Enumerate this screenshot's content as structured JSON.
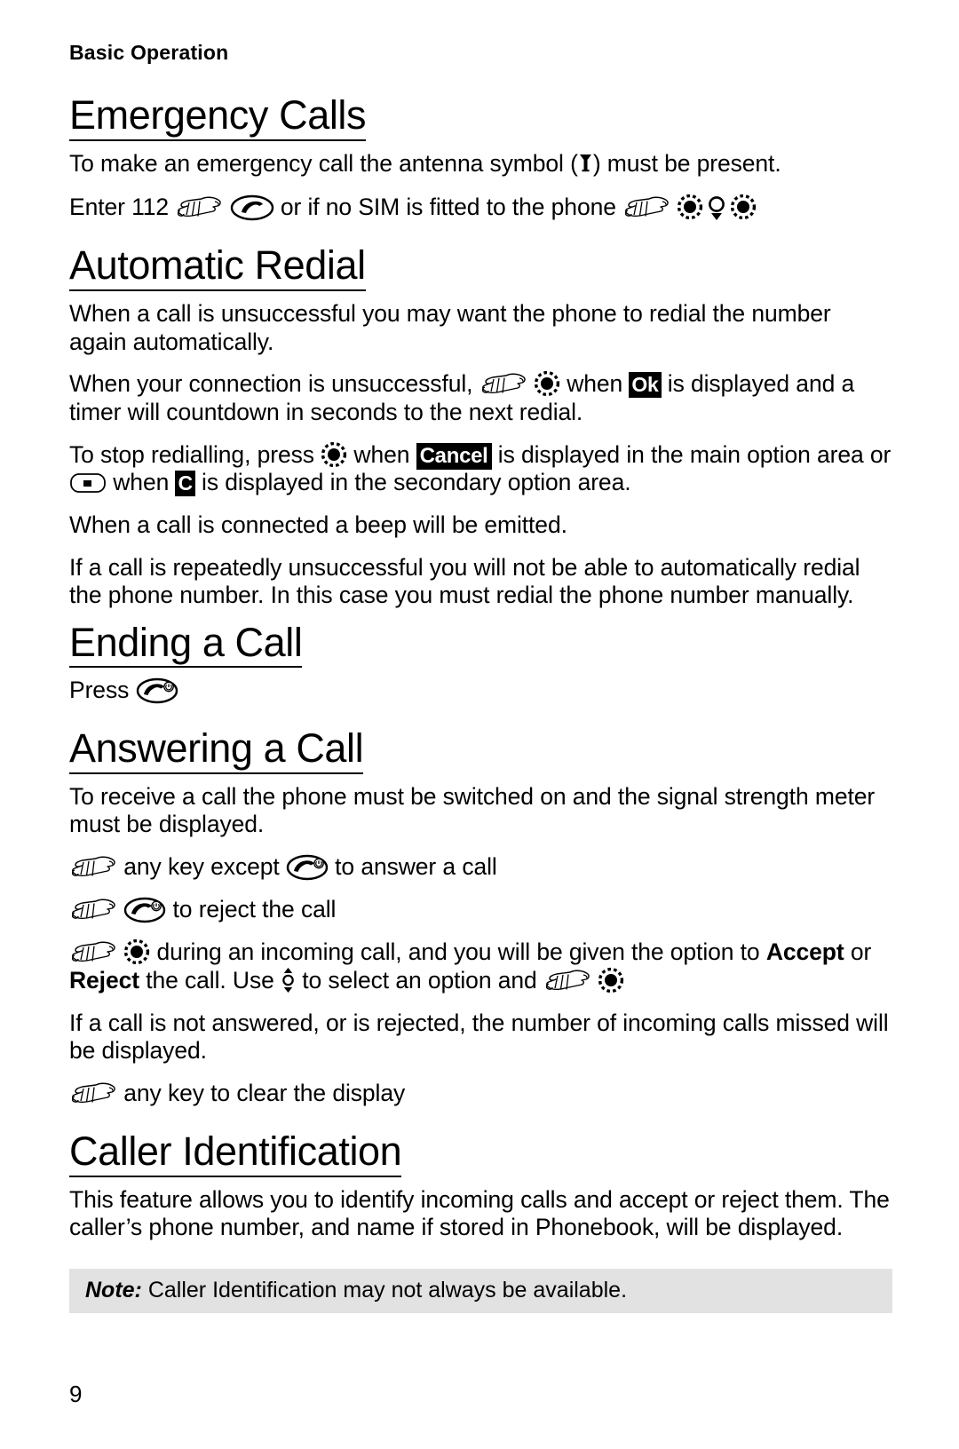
{
  "page": {
    "running_head": "Basic Operation",
    "folio": "9",
    "background": "#ffffff",
    "text_color": "#000000",
    "note_background": "#e2e2e2"
  },
  "sections": [
    {
      "id": "emergency-calls",
      "heading": "Emergency Calls",
      "paragraphs": [
        {
          "id": "emergency-antenna",
          "parts": [
            {
              "type": "text",
              "value": "To make an emergency call the antenna symbol ("
            },
            {
              "type": "icon",
              "icon": "antenna-icon"
            },
            {
              "type": "text",
              "value": ") must be present."
            }
          ]
        },
        {
          "id": "emergency-enter-112",
          "parts": [
            {
              "type": "text",
              "value": "Enter 112 "
            },
            {
              "type": "icon",
              "icon": "press-hand-icon"
            },
            {
              "type": "text",
              "value": " "
            },
            {
              "type": "icon",
              "icon": "send-key-icon"
            },
            {
              "type": "text",
              "value": " or if no SIM is fitted to the phone "
            },
            {
              "type": "icon",
              "icon": "press-hand-icon"
            },
            {
              "type": "text",
              "value": " "
            },
            {
              "type": "icon",
              "icon": "select-key-icon"
            },
            {
              "type": "icon",
              "icon": "navigation-key-icon"
            },
            {
              "type": "icon",
              "icon": "select-key-icon"
            }
          ]
        }
      ]
    },
    {
      "id": "automatic-redial",
      "heading": "Automatic Redial",
      "paragraphs": [
        {
          "id": "redial-intro",
          "parts": [
            {
              "type": "text",
              "value": "When a call is unsuccessful you may want the phone to redial the number again automatically."
            }
          ]
        },
        {
          "id": "redial-ok",
          "parts": [
            {
              "type": "text",
              "value": "When your connection is unsuccessful, "
            },
            {
              "type": "icon",
              "icon": "press-hand-icon"
            },
            {
              "type": "text",
              "value": " "
            },
            {
              "type": "icon",
              "icon": "select-key-icon"
            },
            {
              "type": "text",
              "value": " when "
            },
            {
              "type": "badge",
              "value": "Ok"
            },
            {
              "type": "text",
              "value": " is displayed and a timer will countdown in seconds to the next redial."
            }
          ]
        },
        {
          "id": "redial-cancel",
          "parts": [
            {
              "type": "text",
              "value": "To stop redialling, press "
            },
            {
              "type": "icon",
              "icon": "select-key-icon"
            },
            {
              "type": "text",
              "value": "  when "
            },
            {
              "type": "badge",
              "value": "Cancel"
            },
            {
              "type": "text",
              "value": " is displayed in the main option area or "
            },
            {
              "type": "icon",
              "icon": "soft-key-icon"
            },
            {
              "type": "text",
              "value": " when "
            },
            {
              "type": "badge",
              "value": "C"
            },
            {
              "type": "text",
              "value": " is displayed in the secondary option area."
            }
          ]
        },
        {
          "id": "redial-beep",
          "parts": [
            {
              "type": "text",
              "value": "When a call is connected a beep will be emitted."
            }
          ]
        },
        {
          "id": "redial-manual",
          "parts": [
            {
              "type": "text",
              "value": "If a call is repeatedly unsuccessful you will not be able to automatically redial the phone number. In this case you must redial the phone number manually."
            }
          ]
        }
      ]
    },
    {
      "id": "ending-a-call",
      "heading": "Ending a Call",
      "paragraphs": [
        {
          "id": "ending-press",
          "parts": [
            {
              "type": "text",
              "value": "Press "
            },
            {
              "type": "icon",
              "icon": "end-key-icon"
            }
          ]
        }
      ]
    },
    {
      "id": "answering-a-call",
      "heading": "Answering a Call",
      "paragraphs": [
        {
          "id": "answering-intro",
          "parts": [
            {
              "type": "text",
              "value": "To receive a call the phone must be switched on and the signal strength meter must be displayed."
            }
          ]
        },
        {
          "id": "answering-anykey",
          "indent": true,
          "parts": [
            {
              "type": "icon",
              "icon": "press-hand-icon"
            },
            {
              "type": "text",
              "value": " any key except "
            },
            {
              "type": "icon",
              "icon": "end-key-icon"
            },
            {
              "type": "text",
              "value": " to answer a call"
            }
          ]
        },
        {
          "id": "answering-reject",
          "indent": true,
          "parts": [
            {
              "type": "icon",
              "icon": "press-hand-icon"
            },
            {
              "type": "text",
              "value": "  "
            },
            {
              "type": "icon",
              "icon": "end-key-icon"
            },
            {
              "type": "text",
              "value": " to reject the call"
            }
          ]
        },
        {
          "id": "answering-options",
          "indent": true,
          "parts": [
            {
              "type": "icon",
              "icon": "press-hand-icon"
            },
            {
              "type": "text",
              "value": " "
            },
            {
              "type": "icon",
              "icon": "select-key-icon"
            },
            {
              "type": "text",
              "value": " during an incoming call, and you will be given the option to "
            },
            {
              "type": "bold",
              "value": "Accept"
            },
            {
              "type": "text",
              "value": " or "
            },
            {
              "type": "bold",
              "value": "Reject"
            },
            {
              "type": "text",
              "value": " the call. Use "
            },
            {
              "type": "icon",
              "icon": "navigation-key-small-icon"
            },
            {
              "type": "text",
              "value": " to select an option and "
            },
            {
              "type": "icon",
              "icon": "press-hand-icon"
            },
            {
              "type": "text",
              "value": " "
            },
            {
              "type": "icon",
              "icon": "select-key-icon"
            }
          ]
        },
        {
          "id": "answering-missed",
          "parts": [
            {
              "type": "text",
              "value": "If a call is not answered, or is rejected, the number of incoming calls missed will be displayed."
            }
          ]
        },
        {
          "id": "answering-clear",
          "indent": true,
          "parts": [
            {
              "type": "icon",
              "icon": "press-hand-icon"
            },
            {
              "type": "text",
              "value": " any key to clear the display"
            }
          ]
        }
      ]
    },
    {
      "id": "caller-identification",
      "heading": "Caller Identification",
      "paragraphs": [
        {
          "id": "callerid-intro",
          "parts": [
            {
              "type": "text",
              "value": "This feature allows you to identify incoming calls and accept or reject them. The caller’s phone number, and name if stored in Phonebook, will be displayed."
            }
          ]
        }
      ]
    }
  ],
  "note": {
    "label": "Note:",
    "text": " Caller Identification may not always be available."
  }
}
